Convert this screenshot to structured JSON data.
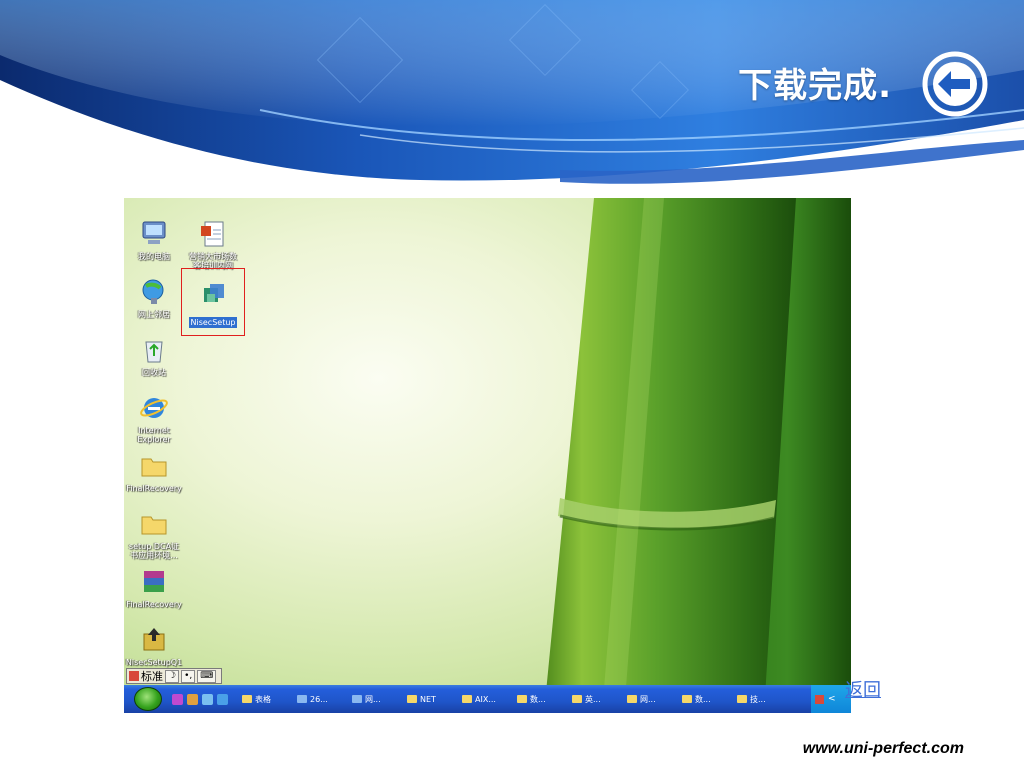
{
  "slide": {
    "title": "下载完成.",
    "back_button_icon": "arrow-left-circle-icon",
    "return_link": "返回",
    "footer_url": "www.uni-perfect.com"
  },
  "desktop": {
    "icons": [
      {
        "label": "我的电脑",
        "icon": "my-computer-icon"
      },
      {
        "label": "营销大市场数\n客培训内网",
        "icon": "document-icon"
      },
      {
        "label": "NisecSetup",
        "icon": "setup-icon",
        "selected": true
      },
      {
        "label": "网上邻居",
        "icon": "network-icon"
      },
      {
        "label": "回收站",
        "icon": "recycle-bin-icon"
      },
      {
        "label": "Internet\nExplorer",
        "icon": "internet-explorer-icon"
      },
      {
        "label": "FinalRecovery",
        "icon": "folder-icon"
      },
      {
        "label": "setup DCA证\n书应用环境...",
        "icon": "folder-icon"
      },
      {
        "label": "FinalRecovery",
        "icon": "winrar-icon"
      },
      {
        "label": "NisecSetupQ1",
        "icon": "winrar-icon"
      }
    ]
  },
  "ime_bar": {
    "mode": "标准",
    "moon": "☽",
    "punct": "•,",
    "keyboard": "⌨"
  },
  "taskbar": {
    "start_icon": "windows-start-icon",
    "buttons": [
      {
        "label": "表格",
        "icon": "folder-icon"
      },
      {
        "label": "26...",
        "icon": "word-icon"
      },
      {
        "label": "网...",
        "icon": "word-icon"
      },
      {
        "label": "NET",
        "icon": "folder-icon"
      },
      {
        "label": "AIX...",
        "icon": "folder-icon"
      },
      {
        "label": "数...",
        "icon": "folder-icon"
      },
      {
        "label": "英...",
        "icon": "folder-icon"
      },
      {
        "label": "网...",
        "icon": "folder-icon"
      },
      {
        "label": "数...",
        "icon": "folder-icon"
      },
      {
        "label": "技...",
        "icon": "folder-icon"
      }
    ],
    "tray_arrow": "<"
  },
  "colors": {
    "header_blue": "#1a4fa3",
    "header_light": "#4a8fe0",
    "link": "#3f6fd8",
    "highlight": "#e0201e",
    "taskbar": "#245edb"
  }
}
